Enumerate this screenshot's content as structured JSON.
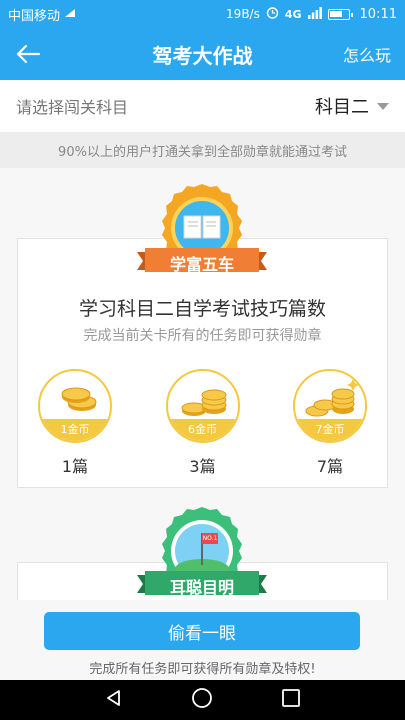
{
  "status_bar": {
    "carrier": "中国移动",
    "net_speed": "19B/s",
    "network": "4G",
    "time": "10:11"
  },
  "app_bar": {
    "title": "驾考大作战",
    "action": "怎么玩",
    "back_icon": "arrow-left-icon"
  },
  "subject": {
    "label": "请选择闯关科目",
    "value": "科目二"
  },
  "notice": "90%以上的用户打通关拿到全部勋章就能通过考试",
  "levels": [
    {
      "badge": "学富五车",
      "title": "学习科目二自学考试技巧篇数",
      "subtitle": "完成当前关卡所有的任务即可获得勋章",
      "rewards": [
        {
          "coins": "1金币",
          "count": "1篇"
        },
        {
          "coins": "6金币",
          "count": "3篇"
        },
        {
          "coins": "7金币",
          "count": "7篇"
        }
      ]
    },
    {
      "badge": "耳聪目明",
      "flag_text": "NO.1"
    }
  ],
  "footer": {
    "button": "偷看一眼",
    "note": "完成所有任务即可获得所有勋章及特权!"
  },
  "colors": {
    "primary": "#2aa7ee",
    "gold": "#f5c842",
    "ribbon_orange": "#f07e35",
    "ribbon_green": "#2fa86a"
  }
}
